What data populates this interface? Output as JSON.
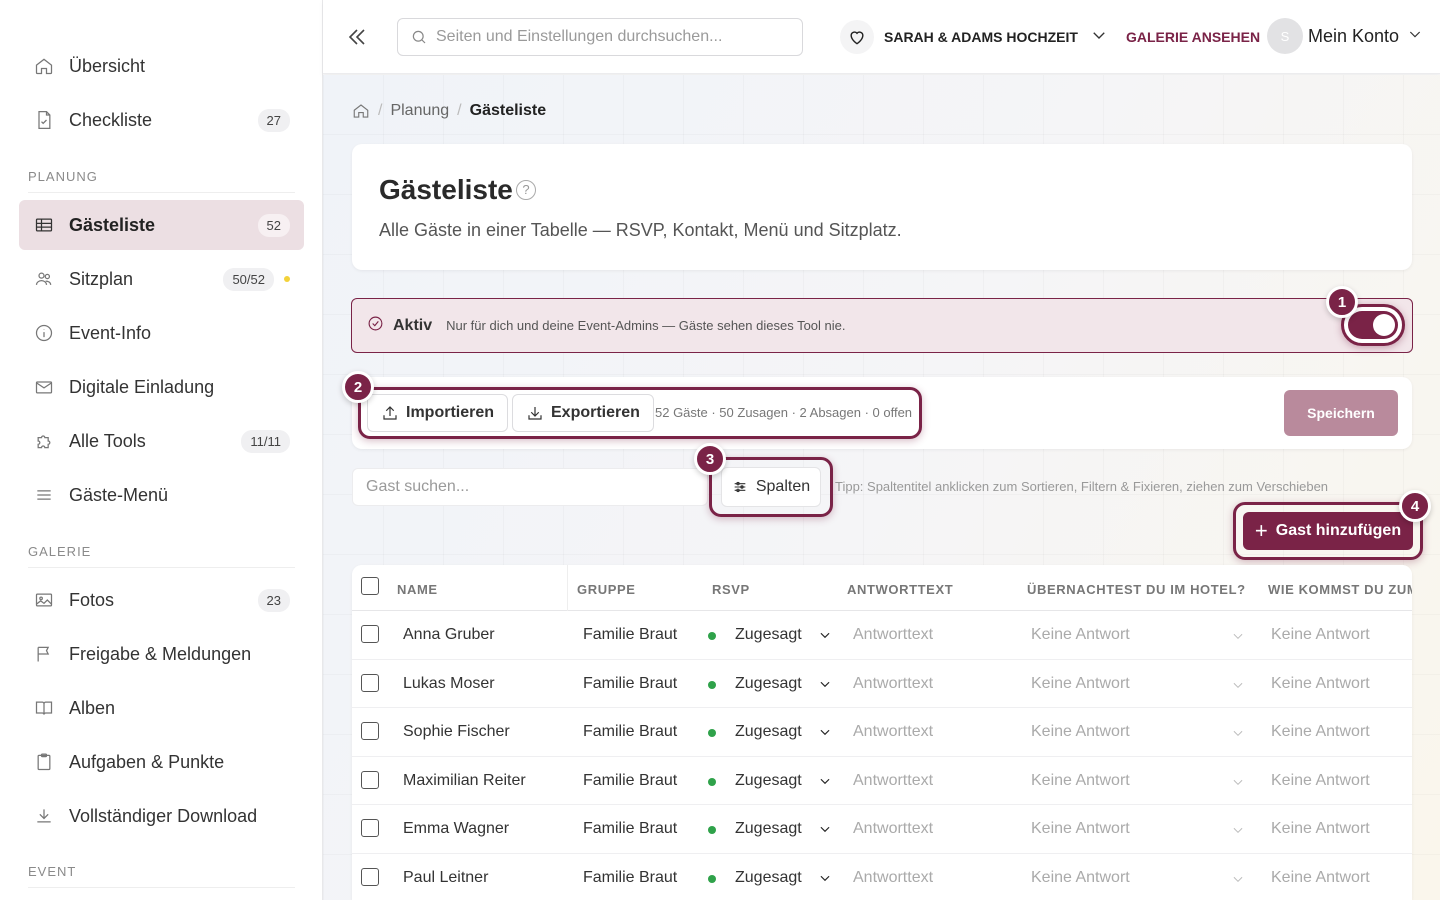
{
  "sidebar": {
    "items_top": [
      {
        "label": "Übersicht",
        "icon": "home-icon"
      },
      {
        "label": "Checkliste",
        "icon": "file-check-icon",
        "badge": "27"
      }
    ],
    "section_planung": "PLANUNG",
    "items_planung": [
      {
        "label": "Gästeliste",
        "icon": "table-icon",
        "badge": "52",
        "active": true
      },
      {
        "label": "Sitzplan",
        "icon": "users-icon",
        "badge": "50/52"
      },
      {
        "label": "Event-Info",
        "icon": "info-icon"
      },
      {
        "label": "Digitale Einladung",
        "icon": "mail-icon"
      },
      {
        "label": "Alle Tools",
        "icon": "puzzle-icon",
        "badge": "11/11"
      },
      {
        "label": "Gäste-Menü",
        "icon": "menu-icon"
      }
    ],
    "section_galerie": "GALERIE",
    "items_galerie": [
      {
        "label": "Fotos",
        "icon": "image-icon",
        "badge": "23"
      },
      {
        "label": "Freigabe & Meldungen",
        "icon": "flag-icon"
      },
      {
        "label": "Alben",
        "icon": "book-icon"
      },
      {
        "label": "Aufgaben & Punkte",
        "icon": "clipboard-icon"
      },
      {
        "label": "Vollständiger Download",
        "icon": "download-icon"
      }
    ],
    "section_event": "EVENT"
  },
  "topbar": {
    "search_placeholder": "Seiten und Einstellungen durchsuchen...",
    "event_name": "SARAH & ADAMS HOCHZEIT",
    "gallery_link": "GALERIE ANSEHEN",
    "avatar_initial": "S",
    "account_label": "Mein Konto"
  },
  "breadcrumb": {
    "parent": "Planung",
    "current": "Gästeliste",
    "separator": "/"
  },
  "header": {
    "title": "Gästeliste",
    "help": "?",
    "subtitle": "Alle Gäste in einer Tabelle — RSVP, Kontakt, Menü und Sitzplatz."
  },
  "status_bar": {
    "status": "Aktiv",
    "message": "Nur für dich und deine Event-Admins — Gäste sehen dieses Tool nie.",
    "toggle_on": true
  },
  "steps": [
    "1",
    "2",
    "3",
    "4"
  ],
  "actions": {
    "import_label": "Importieren",
    "export_label": "Exportieren",
    "stats": "52 Gäste · 50 Zusagen · 2 Absagen · 0 offen",
    "save_label": "Speichern"
  },
  "toolbar": {
    "guest_search_placeholder": "Gast suchen...",
    "columns_label": "Spalten",
    "tip": "Tipp: Spaltentitel anklicken zum Sortieren, Filtern & Fixieren, ziehen zum Verschieben",
    "add_guest_label": "Gast hinzufügen",
    "add_plus": "+"
  },
  "table": {
    "headers": [
      "NAME",
      "GRUPPE",
      "RSVP",
      "ANTWORTTEXT",
      "ÜBERNACHTEST DU IM HOTEL?",
      "WIE KOMMST DU ZUM"
    ],
    "rows": [
      {
        "name": "Anna Gruber",
        "group": "Familie Braut",
        "rsvp": "Zugesagt",
        "answer": "Antworttext",
        "hotel": "Keine Antwort",
        "travel": "Keine Antwort"
      },
      {
        "name": "Lukas Moser",
        "group": "Familie Braut",
        "rsvp": "Zugesagt",
        "answer": "Antworttext",
        "hotel": "Keine Antwort",
        "travel": "Keine Antwort"
      },
      {
        "name": "Sophie Fischer",
        "group": "Familie Braut",
        "rsvp": "Zugesagt",
        "answer": "Antworttext",
        "hotel": "Keine Antwort",
        "travel": "Keine Antwort"
      },
      {
        "name": "Maximilian Reiter",
        "group": "Familie Braut",
        "rsvp": "Zugesagt",
        "answer": "Antworttext",
        "hotel": "Keine Antwort",
        "travel": "Keine Antwort"
      },
      {
        "name": "Emma Wagner",
        "group": "Familie Braut",
        "rsvp": "Zugesagt",
        "answer": "Antworttext",
        "hotel": "Keine Antwort",
        "travel": "Keine Antwort"
      },
      {
        "name": "Paul Leitner",
        "group": "Familie Braut",
        "rsvp": "Zugesagt",
        "answer": "Antworttext",
        "hotel": "Keine Antwort",
        "travel": "Keine Antwort"
      }
    ]
  },
  "colors": {
    "accent": "#7a2347",
    "active_bg": "#ecdfe3",
    "rsvp_yes": "#2fa24a",
    "save_disabled": "#b98a9c"
  }
}
